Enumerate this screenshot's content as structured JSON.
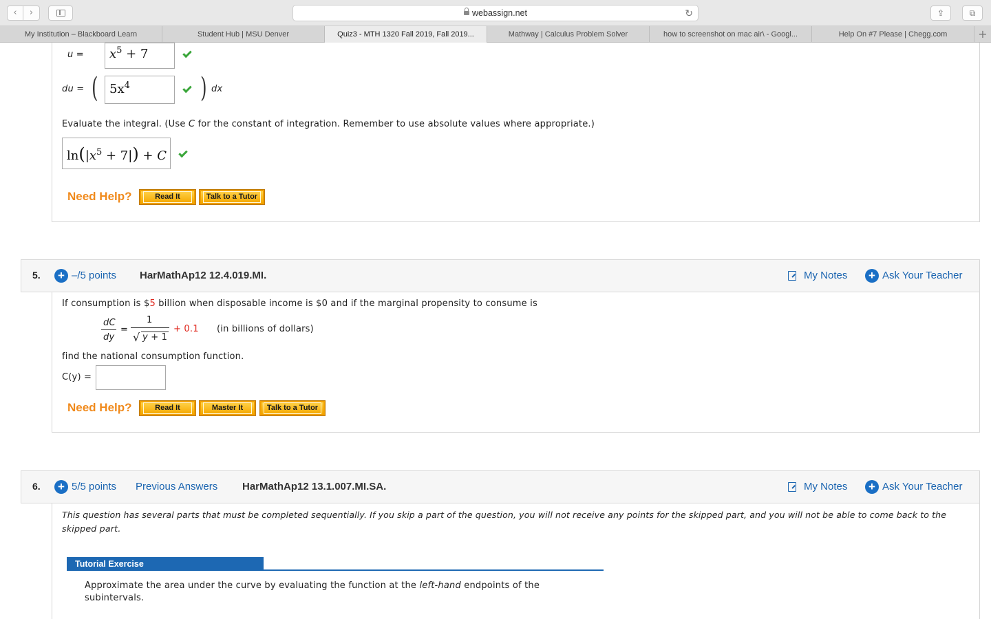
{
  "browser": {
    "url": "webassign.net",
    "nav_back": "‹",
    "nav_forward": "›",
    "tabs": [
      {
        "label": "My Institution – Blackboard Learn"
      },
      {
        "label": "Student Hub | MSU Denver"
      },
      {
        "label": "Quiz3 - MTH 1320 Fall 2019, Fall 2019..."
      },
      {
        "label": "Mathway | Calculus Problem Solver"
      },
      {
        "label": "how to screenshot on mac air\\ - Googl..."
      },
      {
        "label": "Help On #7 Please | Chegg.com"
      }
    ],
    "active_tab": 2
  },
  "q4": {
    "u_label": "u =",
    "u_answer": "x",
    "u_answer_exp": "5",
    "u_answer_rest": " + 7",
    "du_label": "du =",
    "du_answer": "5x",
    "du_answer_exp": "4",
    "dx_label": "dx",
    "instruction_pre": "Evaluate the integral. (Use ",
    "instruction_var": "C",
    "instruction_post": " for the constant of integration. Remember to use absolute values where appropriate.)",
    "integral_answer_ln": "ln",
    "integral_answer_x": "x",
    "integral_answer_exp": "5",
    "integral_answer_plus7": " + 7",
    "integral_answer_c": " + C",
    "need_help": "Need Help?",
    "btn_read": "Read It",
    "btn_tutor": "Talk to a Tutor"
  },
  "q5": {
    "number": "5.",
    "points": "–/5 points",
    "code": "HarMathAp12 12.4.019.MI.",
    "my_notes": "My Notes",
    "ask_teacher": "Ask Your Teacher",
    "text_pre": "If consumption is $",
    "text_value": "5",
    "text_post": " billion when disposable income is $0 and if the marginal propensity to consume is",
    "frac_num": "dC",
    "frac_den": "dy",
    "equals": "=",
    "rhs_num": "1",
    "rhs_den": "y + 1",
    "plus_const": "+ 0.1",
    "units": "(in billions of dollars)",
    "find_text": "find the national consumption function.",
    "cy_label": "C(y) =",
    "cy_value": "",
    "need_help": "Need Help?",
    "btn_read": "Read It",
    "btn_master": "Master It",
    "btn_tutor": "Talk to a Tutor"
  },
  "q6": {
    "number": "6.",
    "points": "5/5 points",
    "previous_answers": "Previous Answers",
    "code": "HarMathAp12 13.1.007.MI.SA.",
    "my_notes": "My Notes",
    "ask_teacher": "Ask Your Teacher",
    "notice_line1": "This question has several parts that must be completed sequentially. If you skip a part of the question, you will not receive any points for the skipped part, and you will not be able to come back to the",
    "notice_line2": "skipped part.",
    "tutorial_header": "Tutorial Exercise",
    "tutorial_text1_pre": "Approximate the area under the curve by evaluating the function at the ",
    "tutorial_text1_ital": "left-hand",
    "tutorial_text1_post": " endpoints of the",
    "tutorial_text2": "subintervals."
  },
  "colors": {
    "link_blue": "#1a64b0",
    "help_orange": "#f08a1c",
    "button_yellow": "#f5b800",
    "check_green": "#3aa63a",
    "value_red": "#e0261c",
    "tutorial_blue": "#1d68b3"
  }
}
